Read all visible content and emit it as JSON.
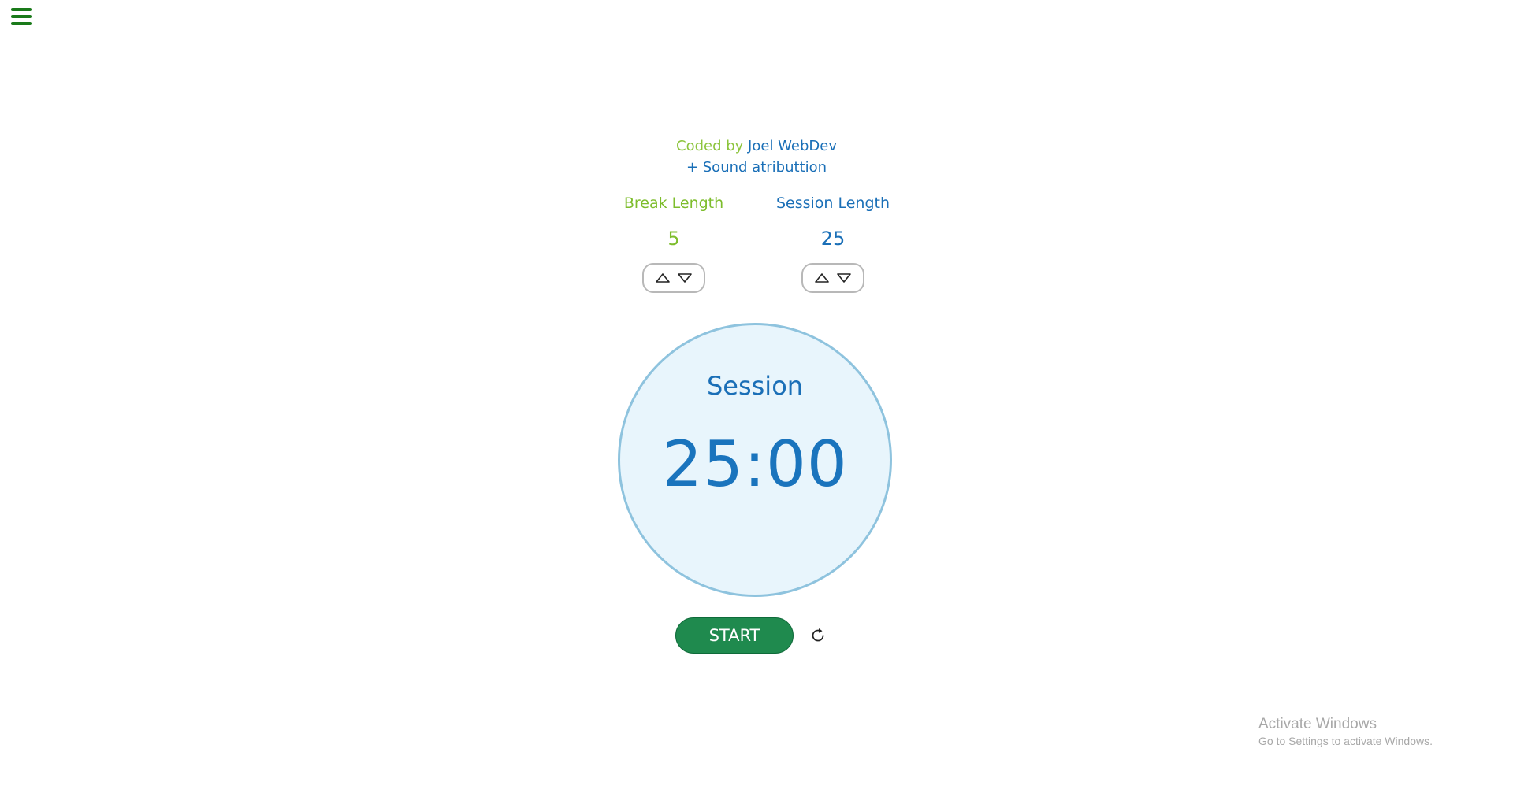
{
  "menu": {
    "icon": "hamburger-menu-icon"
  },
  "credits": {
    "coded_by": "Coded by",
    "author": "Joel WebDev",
    "sound_attribution": "+ Sound atributtion"
  },
  "break": {
    "label": "Break Length",
    "value": "5",
    "color": "#7dbd2c"
  },
  "session": {
    "label": "Session Length",
    "value": "25",
    "color": "#1a6fb7"
  },
  "timer": {
    "mode": "Session",
    "time": "25:00"
  },
  "controls": {
    "start_label": "START",
    "reset_icon": "reset-icon"
  },
  "os_watermark": {
    "title": "Activate Windows",
    "subtitle": "Go to Settings to activate Windows."
  },
  "colors": {
    "accent_green": "#1f8a4e",
    "accent_blue": "#1a6fb7",
    "clock_fill": "#e8f5fc",
    "clock_border": "#8ec3de"
  }
}
